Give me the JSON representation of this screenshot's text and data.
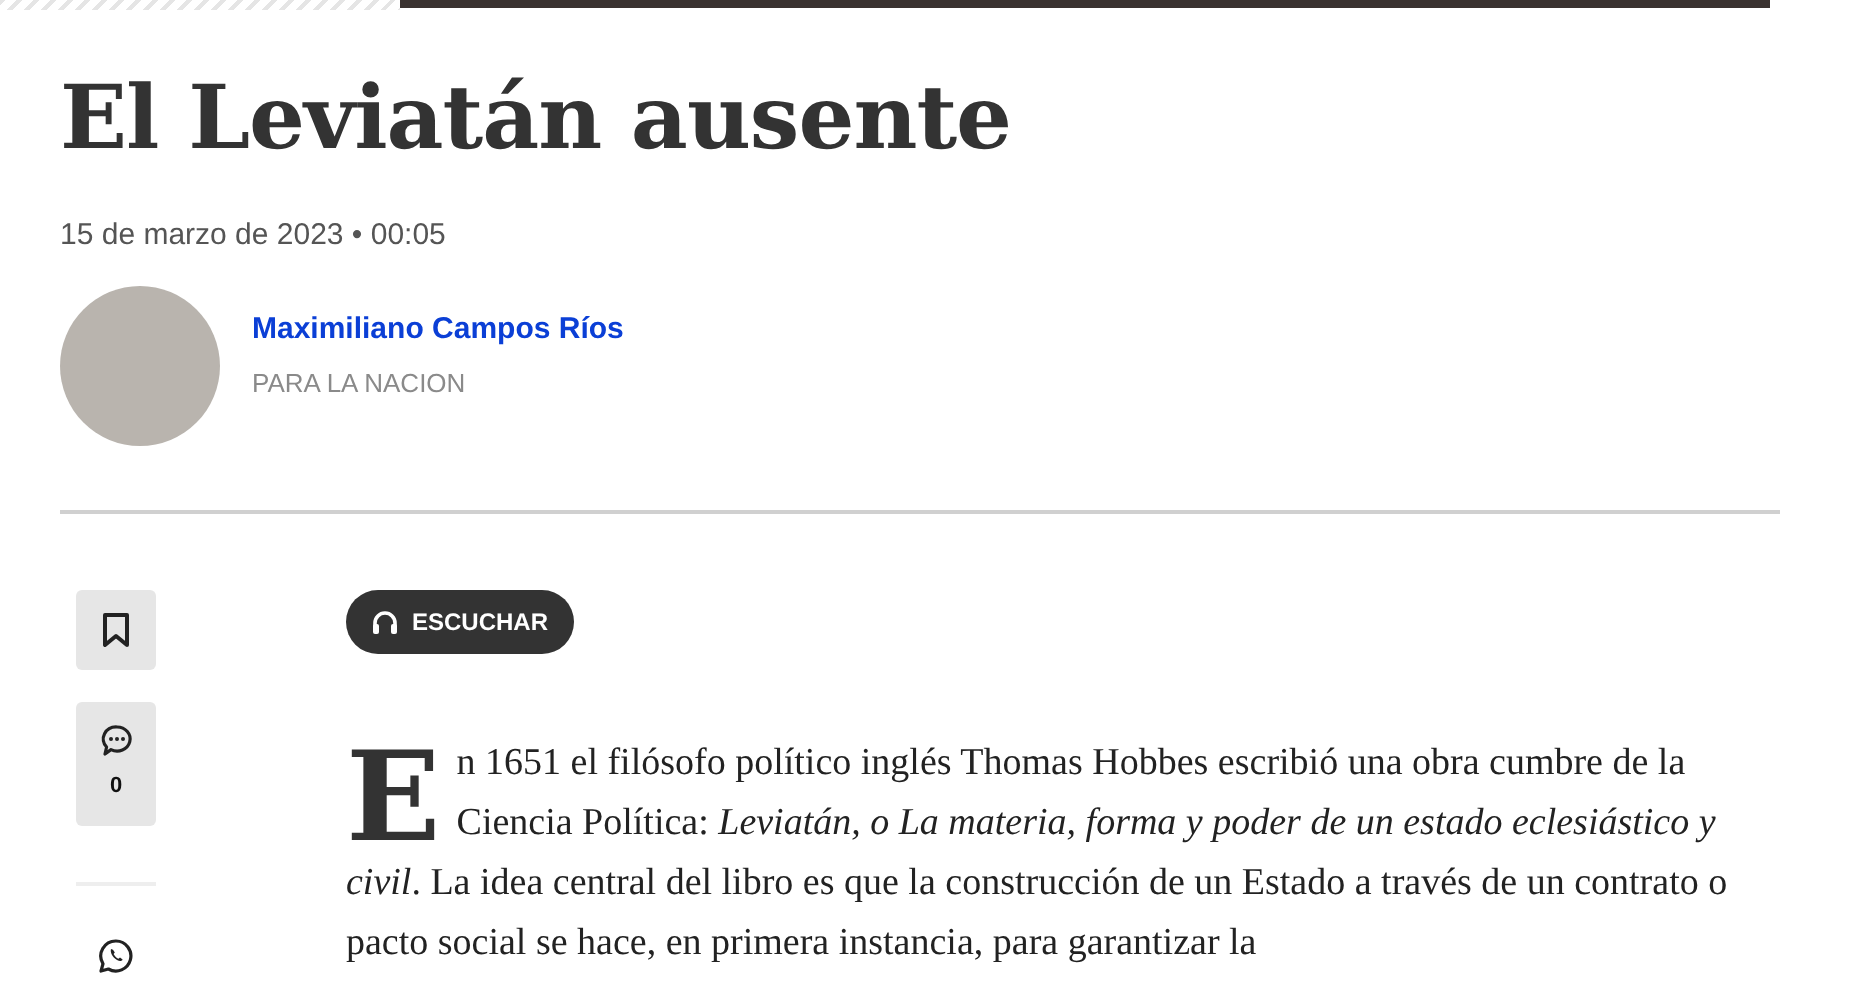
{
  "article": {
    "title": "El Leviatán ausente",
    "date": "15 de marzo de 2023 • 00:05"
  },
  "author": {
    "name": "Maximiliano Campos Ríos",
    "outlet": "PARA LA NACION"
  },
  "share_bar": {
    "comments_count": "0"
  },
  "listen_button": {
    "label": "ESCUCHAR"
  },
  "body": {
    "drop_cap": "E",
    "text": "n 1651 el filósofo político inglés Thomas Hobbes escribió una obra cumbre de la Ciencia Política: *Leviatán, o La materia, forma y poder de un estado eclesiástico y civil*. La idea central del libro es que la construcción de un Estado a través de un contrato o pacto social se hace, en primera instancia, para garantizar la"
  }
}
